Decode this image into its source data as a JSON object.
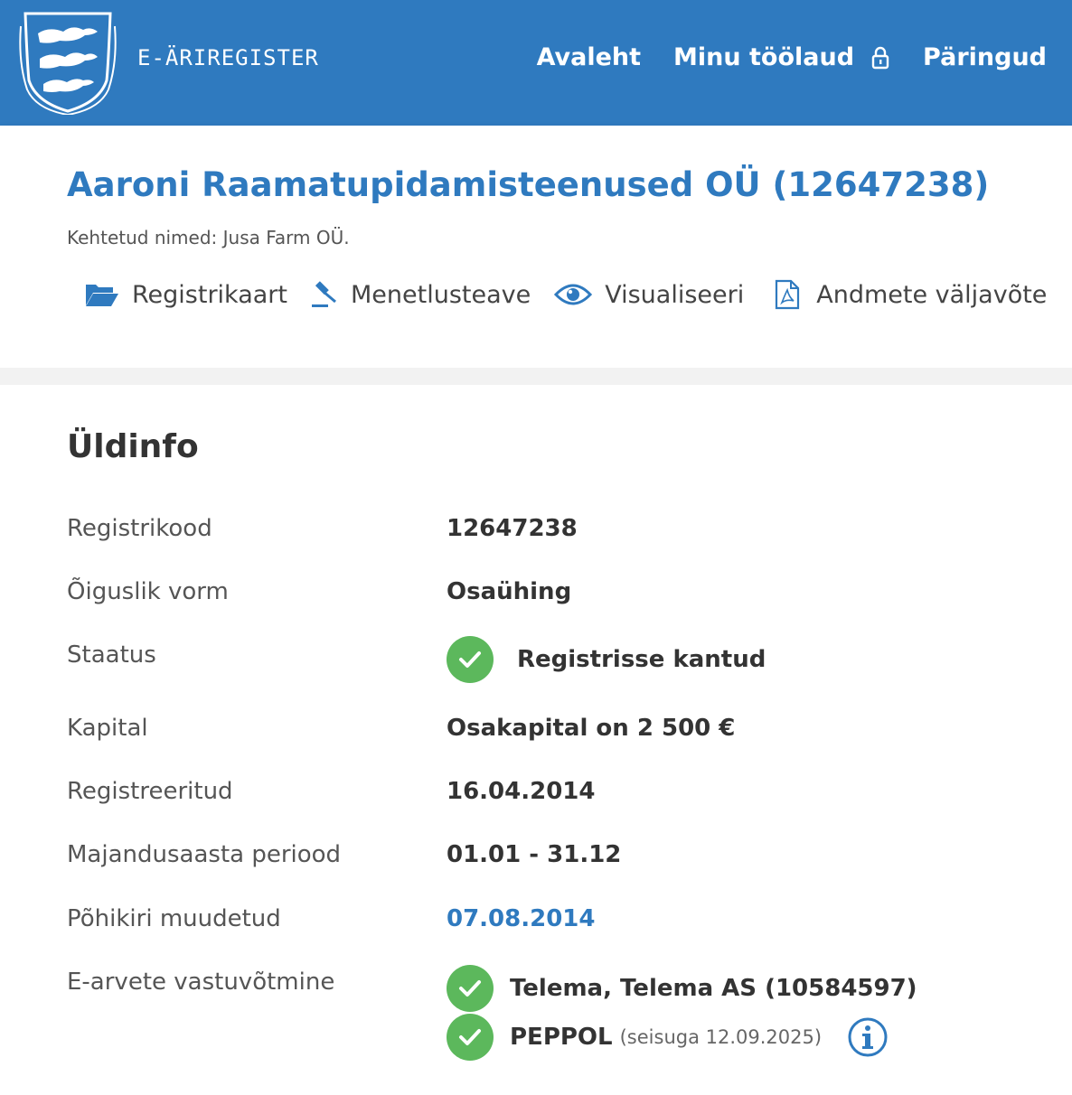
{
  "header": {
    "brand": "E-ÄRIREGISTER",
    "nav": [
      {
        "label": "Avaleht"
      },
      {
        "label": "Minu töölaud"
      },
      {
        "label": "Päringud"
      }
    ]
  },
  "company": {
    "title": "Aaroni Raamatupidamisteenused OÜ (12647238)",
    "aliases": "Kehtetud nimed: Jusa Farm OÜ."
  },
  "actions": [
    {
      "label": "Registrikaart",
      "icon": "folder-open-icon"
    },
    {
      "label": "Menetlusteave",
      "icon": "gavel-icon"
    },
    {
      "label": "Visualiseeri",
      "icon": "eye-icon"
    },
    {
      "label": "Andmete väljavõte",
      "icon": "pdf-file-icon"
    }
  ],
  "general": {
    "title": "Üldinfo",
    "rows": [
      {
        "label": "Registrikood",
        "value": "12647238"
      },
      {
        "label": "Õiguslik vorm",
        "value": "Osaühing"
      },
      {
        "label": "Staatus",
        "value": "Registrisse kantud"
      },
      {
        "label": "Kapital",
        "value": "Osakapital on 2 500 €"
      },
      {
        "label": "Registreeritud",
        "value": "16.04.2014"
      },
      {
        "label": "Majandusaasta periood",
        "value": "01.01 - 31.12"
      },
      {
        "label": "Põhikiri muudetud",
        "value": "07.08.2014"
      },
      {
        "label": "E-arvete vastuvõtmine",
        "value": "Telema, Telema AS (10584597)",
        "value2": "PEPPOL",
        "note2": "(seisuga 12.09.2025)"
      }
    ]
  },
  "colors": {
    "primary": "#2f7abf",
    "success": "#5cb85c"
  }
}
